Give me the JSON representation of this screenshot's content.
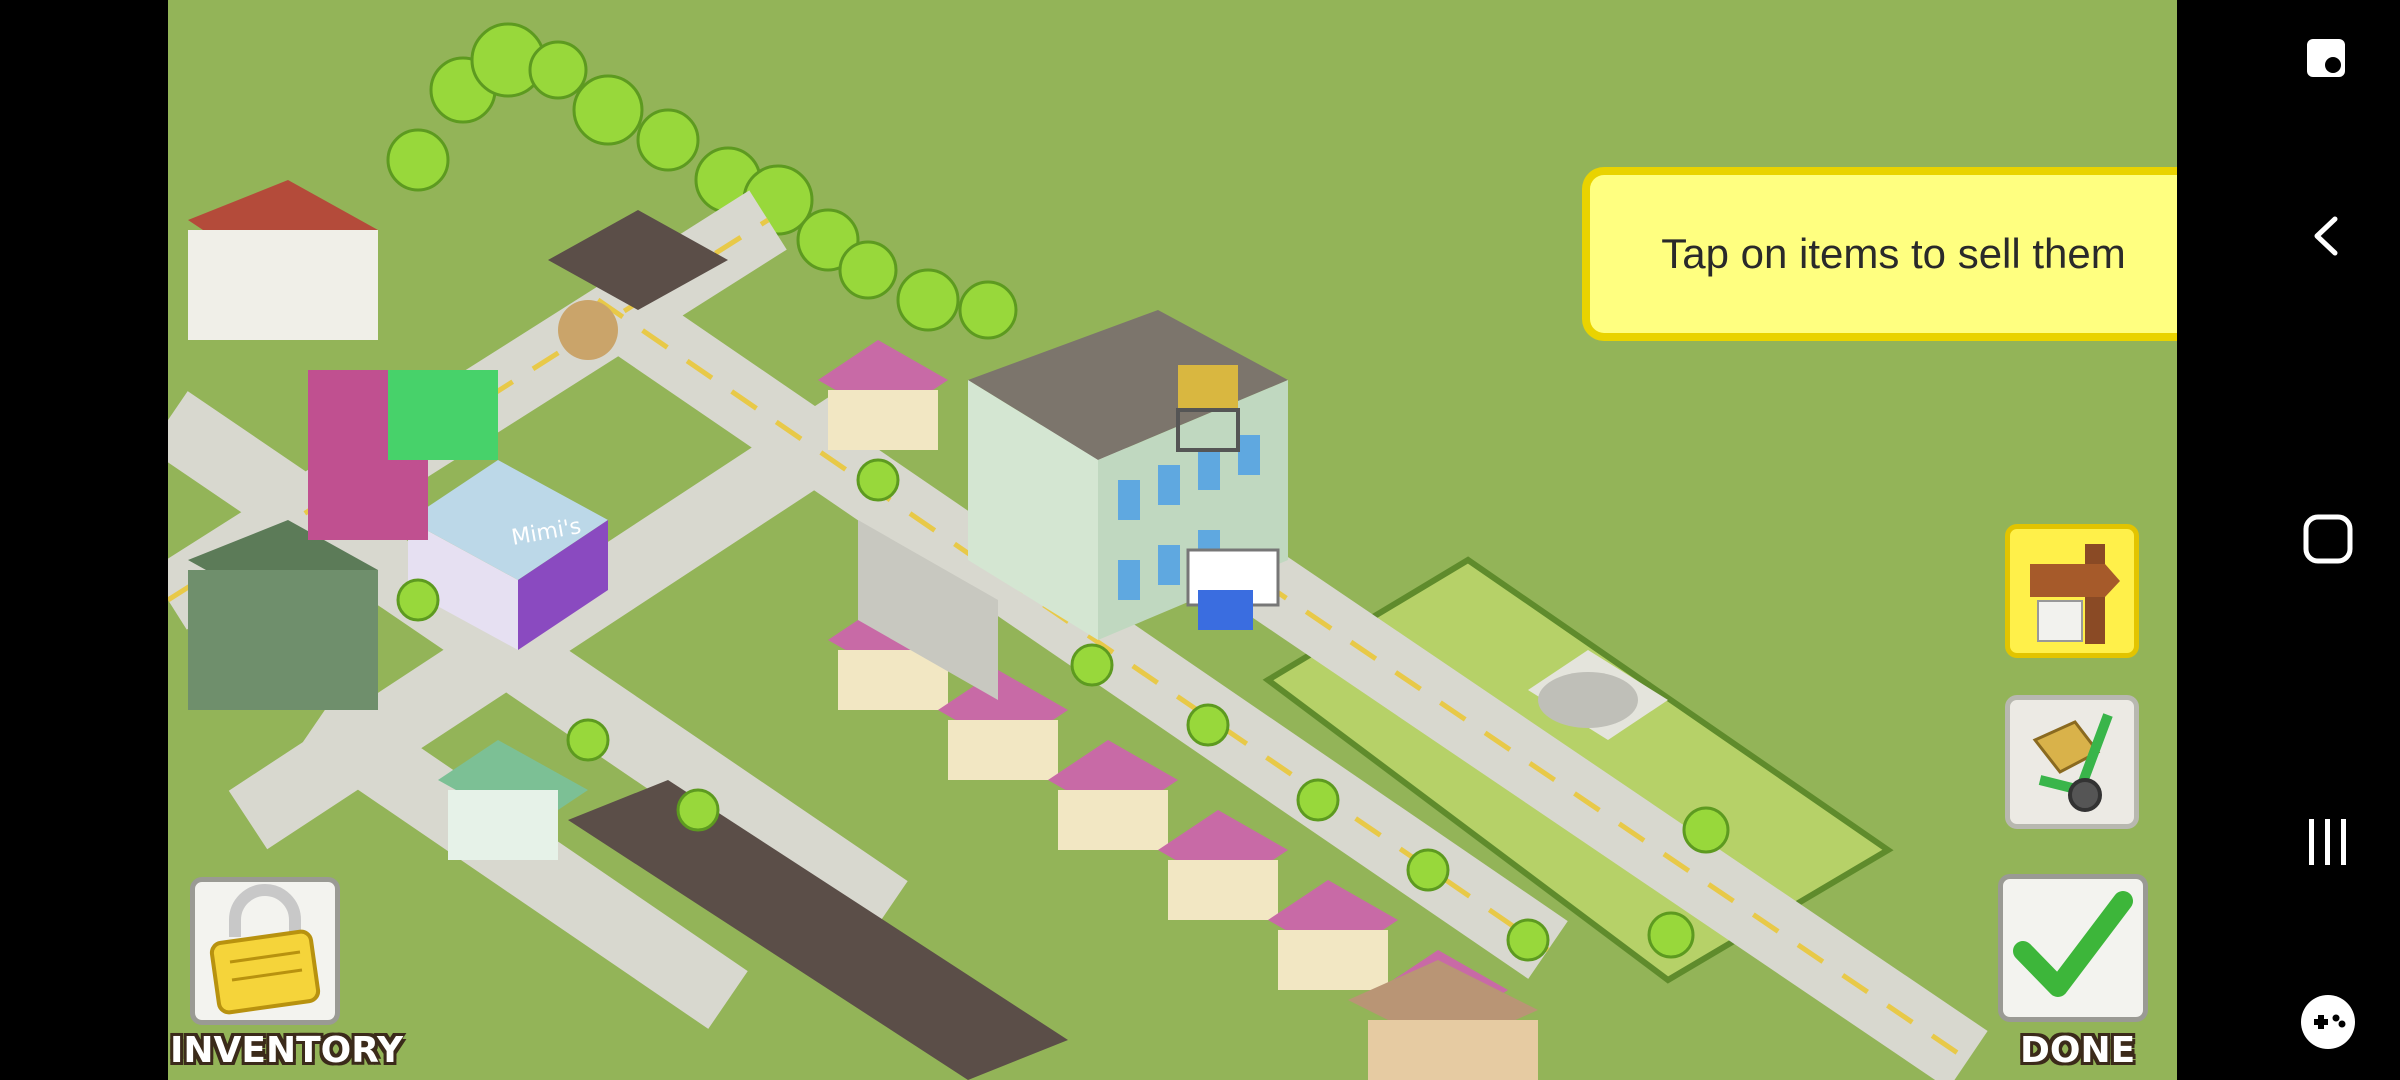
{
  "tooltip": {
    "text": "Tap on items to sell them"
  },
  "buttons": {
    "inventory_label": "INVENTORY",
    "done_label": "DONE",
    "sell_icon": "signpost-icon",
    "move_icon": "hand-truck-icon",
    "done_icon": "checkmark-icon",
    "inventory_icon": "lock-icon"
  },
  "buildings": {
    "cafe_sign": "Mimi's"
  },
  "nav": {
    "items": [
      "screenshot-icon",
      "back-icon",
      "home-icon",
      "recents-icon",
      "game-tools-icon"
    ]
  },
  "colors": {
    "grass": "#93b458",
    "tooltip_bg": "#ffff80",
    "tooltip_border": "#e9d300",
    "road": "#c9c9c0"
  }
}
